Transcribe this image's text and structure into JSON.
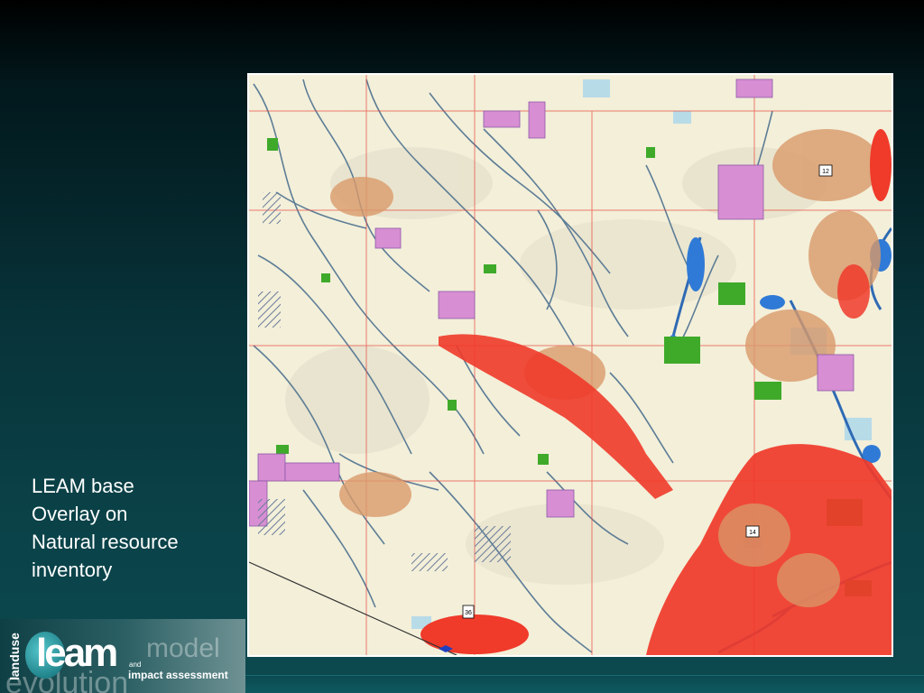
{
  "caption": {
    "line1": "LEAM base",
    "line2": "Overlay on",
    "line3": "Natural resource",
    "line4": "inventory"
  },
  "logo": {
    "vertical_text": "landuse",
    "wordmark": "leam",
    "connector": "and",
    "model": "model",
    "tagline": "impact assessment",
    "evolution": "evolution"
  },
  "map": {
    "shield_labels": [
      "12",
      "14",
      "36"
    ],
    "colors": {
      "background": "#f3efd9",
      "stream": "#5d7d96",
      "urban": "#f03a2a",
      "developed": "#d99a6a",
      "forest": "#3faa2a",
      "water": "#2f7ad6",
      "protected": "#d78ed2",
      "wetland": "#b8dbe8"
    }
  }
}
